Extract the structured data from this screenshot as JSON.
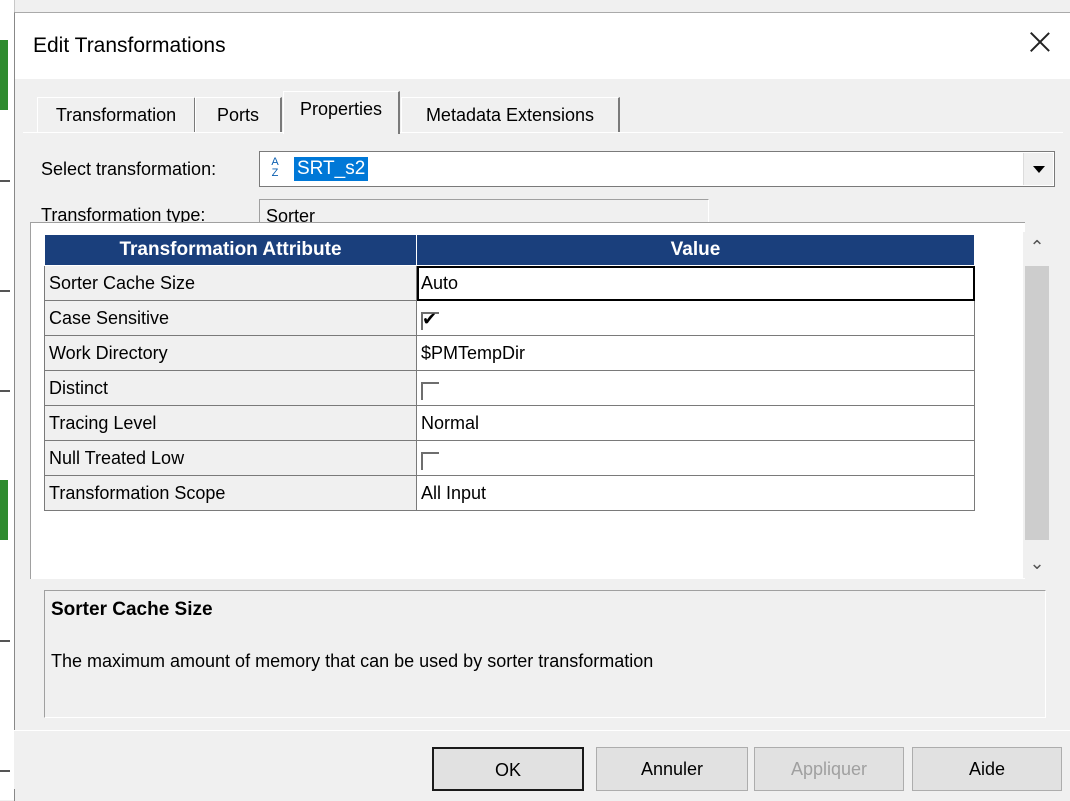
{
  "dialog": {
    "title": "Edit Transformations"
  },
  "tabs": [
    {
      "label": "Transformation",
      "active": false
    },
    {
      "label": "Ports",
      "active": false
    },
    {
      "label": "Properties",
      "active": true
    },
    {
      "label": "Metadata Extensions",
      "active": false
    }
  ],
  "select_transformation": {
    "label": "Select transformation:",
    "value": "SRT_s2",
    "icon": "sort-az-icon"
  },
  "transformation_type": {
    "label": "Transformation type:",
    "value": "Sorter"
  },
  "grid": {
    "headers": [
      "Transformation Attribute",
      "Value"
    ],
    "header_color": "#1a3f7c",
    "rows": [
      {
        "attribute": "Sorter Cache Size",
        "type": "text",
        "value": "Auto"
      },
      {
        "attribute": "Case Sensitive",
        "type": "checkbox",
        "checked": true
      },
      {
        "attribute": "Work Directory",
        "type": "text",
        "value": "$PMTempDir"
      },
      {
        "attribute": "Distinct",
        "type": "checkbox",
        "checked": false
      },
      {
        "attribute": "Tracing Level",
        "type": "text",
        "value": "Normal"
      },
      {
        "attribute": "Null Treated Low",
        "type": "checkbox",
        "checked": false
      },
      {
        "attribute": "Transformation Scope",
        "type": "text",
        "value": "All Input"
      }
    ]
  },
  "description": {
    "title": "Sorter Cache Size",
    "text": "The maximum amount of memory that can be used by sorter transformation"
  },
  "buttons": {
    "ok": "OK",
    "cancel": "Annuler",
    "apply": "Appliquer",
    "help": "Aide"
  }
}
